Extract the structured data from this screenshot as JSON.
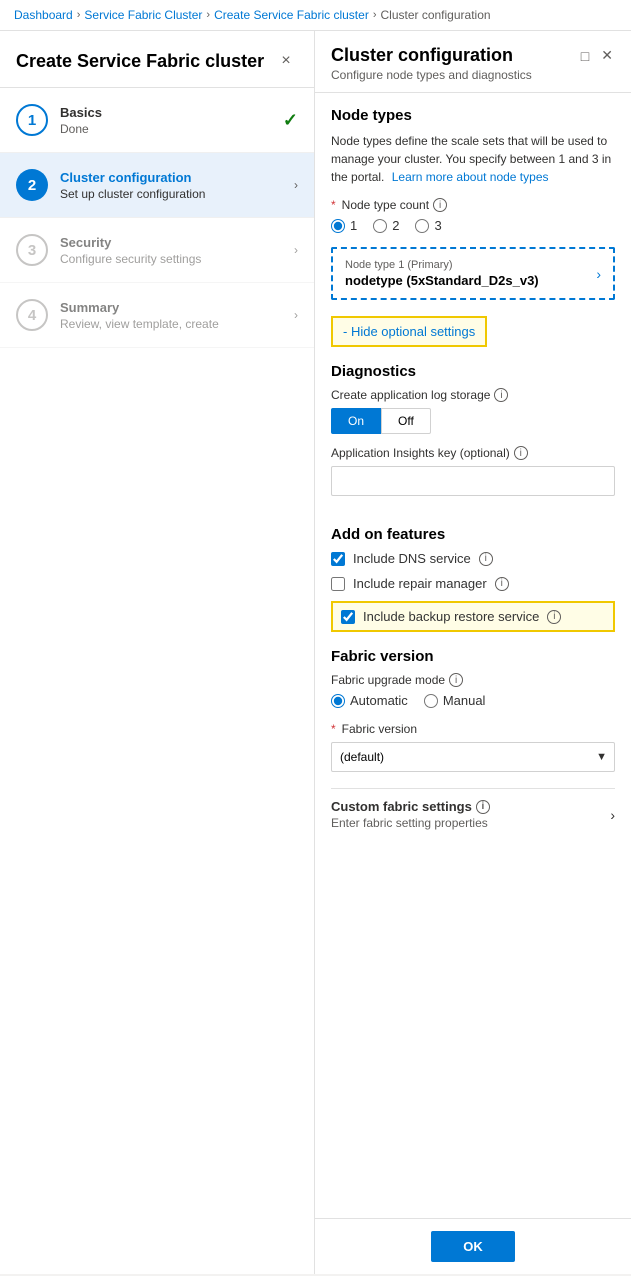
{
  "breadcrumb": {
    "items": [
      "Dashboard",
      "Service Fabric Cluster",
      "Create Service Fabric cluster",
      "Cluster configuration"
    ]
  },
  "left_panel": {
    "title": "Create Service Fabric cluster",
    "close_label": "×",
    "steps": [
      {
        "number": "1",
        "title": "Basics",
        "subtitle": "Done",
        "state": "done"
      },
      {
        "number": "2",
        "title": "Cluster configuration",
        "subtitle": "Set up cluster configuration",
        "state": "active"
      },
      {
        "number": "3",
        "title": "Security",
        "subtitle": "Configure security settings",
        "state": "inactive"
      },
      {
        "number": "4",
        "title": "Summary",
        "subtitle": "Review, view template, create",
        "state": "inactive"
      }
    ]
  },
  "right_panel": {
    "title": "Cluster configuration",
    "subtitle": "Configure node types and diagnostics",
    "node_types": {
      "section_title": "Node types",
      "description": "Node types define the scale sets that will be used to manage your cluster. You specify between 1 and 3 in the portal.",
      "learn_more_text": "Learn more about node types",
      "count_label": "Node type count",
      "count_options": [
        "1",
        "2",
        "3"
      ],
      "selected_count": "1",
      "node_type_label": "Node type 1 (Primary)",
      "node_type_value": "nodetype (5xStandard_D2s_v3)"
    },
    "hide_optional_settings": {
      "label": "- Hide optional settings"
    },
    "diagnostics": {
      "section_title": "Diagnostics",
      "log_storage_label": "Create application log storage",
      "log_storage_on": "On",
      "log_storage_off": "Off",
      "log_storage_selected": "On",
      "app_insights_label": "Application Insights key (optional)",
      "app_insights_placeholder": ""
    },
    "add_on_features": {
      "section_title": "Add on features",
      "dns_service_label": "Include DNS service",
      "dns_service_checked": true,
      "repair_manager_label": "Include repair manager",
      "repair_manager_checked": false,
      "backup_restore_label": "Include backup restore service",
      "backup_restore_checked": true
    },
    "fabric_version": {
      "section_title": "Fabric version",
      "upgrade_mode_label": "Fabric upgrade mode",
      "upgrade_mode_options": [
        "Automatic",
        "Manual"
      ],
      "upgrade_mode_selected": "Automatic",
      "fabric_version_label": "Fabric version",
      "required": true,
      "fabric_version_default": "(default)"
    },
    "custom_fabric_settings": {
      "title": "Custom fabric settings",
      "subtitle": "Enter fabric setting properties"
    },
    "ok_button": "OK"
  }
}
